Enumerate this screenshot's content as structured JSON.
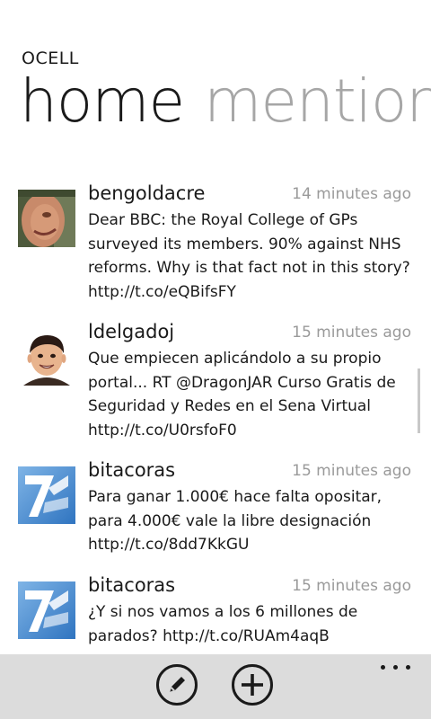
{
  "app_title": "OCELL",
  "pivot": {
    "active": "home",
    "next": "mention"
  },
  "feed": [
    {
      "author": "bengoldacre",
      "time": "14 minutes ago",
      "text": "Dear BBC: the Royal College of GPs surveyed its members. 90% against NHS reforms. Why is that fact not in this story? http://t.co/eQBifsFY",
      "avatar_icon": "profile-photo-icon"
    },
    {
      "author": "ldelgadoj",
      "time": "15 minutes ago",
      "text": "Que empiecen aplicándolo a su propio portal... RT @DragonJAR Curso Gratis de Seguridad y Redes en el Sena Virtual http://t.co/U0rsfoF0",
      "avatar_icon": "cartoon-avatar-icon"
    },
    {
      "author": "bitacoras",
      "time": "15 minutes ago",
      "text": "Para ganar 1.000€ hace falta opositar, para 4.000€ vale la libre designación http://t.co/8dd7KkGU",
      "avatar_icon": "bitacoras-logo-icon"
    },
    {
      "author": "bitacoras",
      "time": "15 minutes ago",
      "text": "¿Y si nos vamos a los 6 millones de parados? http://t.co/RUAm4aqB",
      "avatar_icon": "bitacoras-logo-icon"
    }
  ],
  "app_bar": {
    "buttons": [
      "compose-icon",
      "add-icon"
    ],
    "more": "more-options-icon"
  },
  "colors": {
    "app_bar_bg": "#dcdcdc",
    "inactive_pivot": "#a6a6a6",
    "timestamp": "#9a9a9a",
    "bitacoras_blue": "#4a8fd4"
  }
}
